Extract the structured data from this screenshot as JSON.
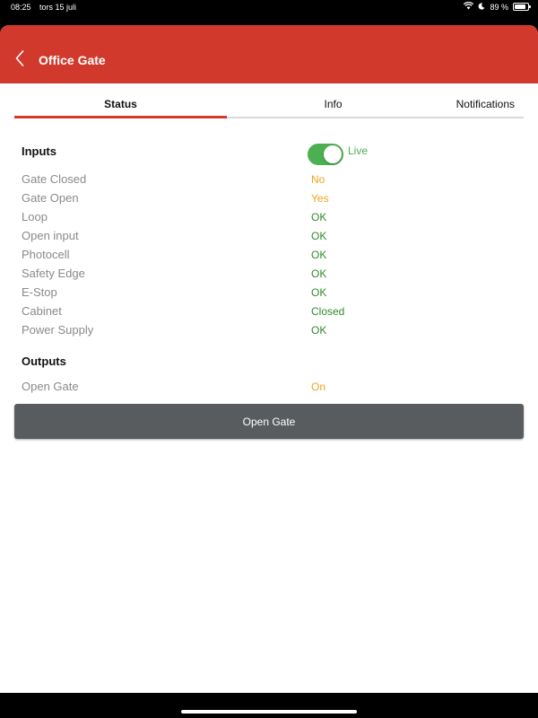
{
  "status_bar": {
    "time": "08:25",
    "date": "tors 15 juli",
    "battery": "89 %",
    "battery_level_pct": 89
  },
  "header": {
    "title": "Office Gate",
    "back_icon": "chevron-left-icon",
    "background_color": "#d2392d"
  },
  "tabs": [
    {
      "label": "Status",
      "active": true
    },
    {
      "label": "Info",
      "active": false
    },
    {
      "label": "Notifications",
      "active": false
    }
  ],
  "inputs": {
    "title": "Inputs",
    "live_label": "Live",
    "live_enabled": true,
    "rows": [
      {
        "label": "Gate Closed",
        "value": "No",
        "status": "warning"
      },
      {
        "label": "Gate Open",
        "value": "Yes",
        "status": "warning"
      },
      {
        "label": "Loop",
        "value": "OK",
        "status": "ok"
      },
      {
        "label": "Open input",
        "value": "OK",
        "status": "ok"
      },
      {
        "label": "Photocell",
        "value": "OK",
        "status": "ok"
      },
      {
        "label": "Safety Edge",
        "value": "OK",
        "status": "ok"
      },
      {
        "label": "E-Stop",
        "value": "OK",
        "status": "ok"
      },
      {
        "label": "Cabinet",
        "value": "Closed",
        "status": "ok"
      },
      {
        "label": "Power Supply",
        "value": "OK",
        "status": "ok"
      }
    ]
  },
  "outputs": {
    "title": "Outputs",
    "rows": [
      {
        "label": "Open Gate",
        "value": "On",
        "status": "warning"
      }
    ]
  },
  "actions": {
    "open_gate_label": "Open Gate"
  },
  "colors": {
    "ok": "#2f8a2a",
    "warning": "#f0a31e",
    "toggle_on": "#4caf50",
    "button": "#595c5f"
  }
}
